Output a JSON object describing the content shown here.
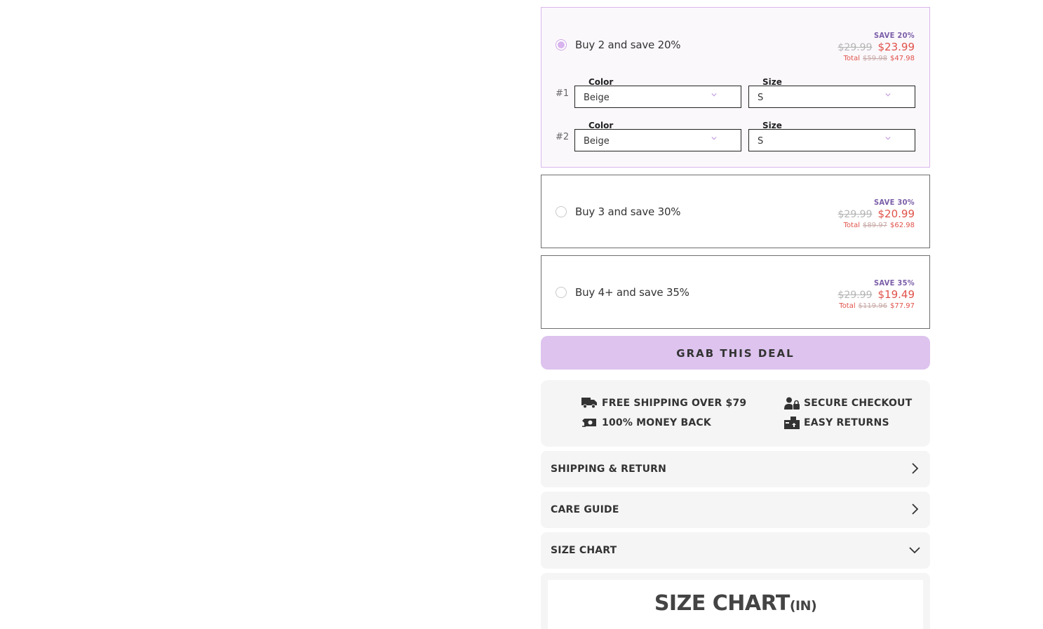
{
  "offers": [
    {
      "label": "Buy 2 and save 20%",
      "save": "SAVE 20%",
      "original_price": "$29.99",
      "sale_price": "$23.99",
      "total_label": "Total",
      "total_original": "$59.98",
      "total_sale": "$47.98",
      "selected": true,
      "variants": [
        {
          "num": "#1",
          "color_label": "Color",
          "color_value": "Beige",
          "size_label": "Size",
          "size_value": "S"
        },
        {
          "num": "#2",
          "color_label": "Color",
          "color_value": "Beige",
          "size_label": "Size",
          "size_value": "S"
        }
      ]
    },
    {
      "label": "Buy 3 and save 30%",
      "save": "SAVE 30%",
      "original_price": "$29.99",
      "sale_price": "$20.99",
      "total_label": "Total",
      "total_original": "$89.97",
      "total_sale": "$62.98",
      "selected": false
    },
    {
      "label": "Buy 4+ and save 35%",
      "save": "SAVE 35%",
      "original_price": "$29.99",
      "sale_price": "$19.49",
      "total_label": "Total",
      "total_original": "$119.96",
      "total_sale": "$77.97",
      "selected": false
    }
  ],
  "cta": {
    "label": "GRAB THIS  DEAL"
  },
  "trust": {
    "free_shipping": "FREE SHIPPING OVER $79",
    "secure_checkout": "SECURE CHECKOUT",
    "money_back": "100% MONEY BACK",
    "easy_returns": "EASY RETURNS"
  },
  "accordion": {
    "shipping": "SHIPPING & RETURN",
    "care": "CARE GUIDE",
    "size_chart": "SIZE CHART"
  },
  "size_chart": {
    "title": "SIZE CHART",
    "unit": "(IN)"
  },
  "colors": {
    "accent": "#ddc3ee",
    "sale": "#e0524a",
    "save": "#7b5ea8"
  }
}
